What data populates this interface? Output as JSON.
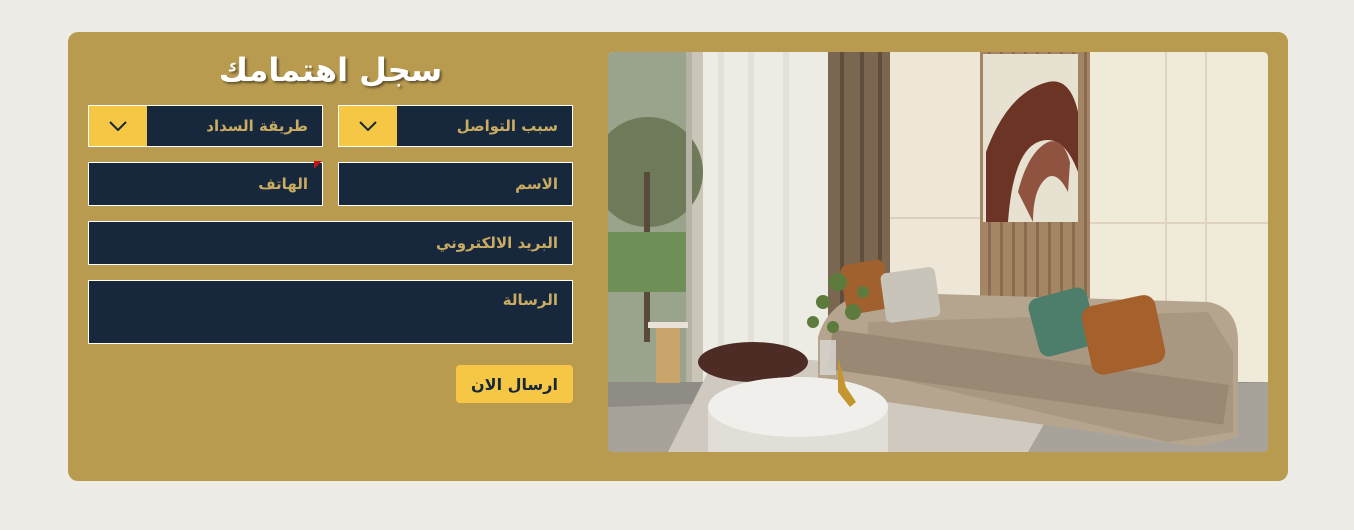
{
  "form": {
    "title": "سجل اهتمامك",
    "contact_reason": {
      "placeholder": "سبب التواصل"
    },
    "payment_method": {
      "placeholder": "طريقة السداد"
    },
    "name": {
      "placeholder": "الاسم"
    },
    "phone": {
      "placeholder": "الهاتف"
    },
    "email": {
      "placeholder": "البريد الالكتروني"
    },
    "message": {
      "placeholder": "الرسالة"
    },
    "submit_label": "ارسال الان"
  },
  "icons": {
    "dropdown": "chevron-down-icon"
  },
  "colors": {
    "panel": "#b89b4f",
    "field_bg": "#17283d",
    "placeholder_text": "#c9ac62",
    "accent": "#f6c744",
    "page_bg": "#eeece7"
  }
}
